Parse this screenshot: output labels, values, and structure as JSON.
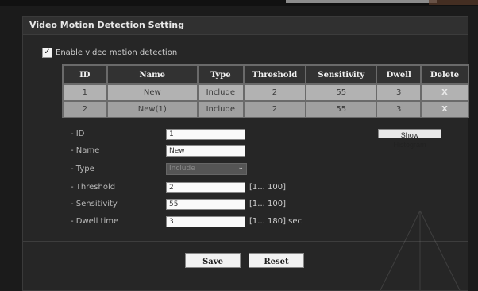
{
  "panel": {
    "title": "Video Motion Detection Setting",
    "enable_checkbox": {
      "checked": true,
      "label": "Enable video motion detection"
    }
  },
  "table": {
    "headers": [
      "ID",
      "Name",
      "Type",
      "Threshold",
      "Sensitivity",
      "Dwell",
      "Delete"
    ],
    "rows": [
      {
        "id": "1",
        "name": "New",
        "type": "Include",
        "threshold": "2",
        "sensitivity": "55",
        "dwell": "3",
        "delete": "X"
      },
      {
        "id": "2",
        "name": "New(1)",
        "type": "Include",
        "threshold": "2",
        "sensitivity": "55",
        "dwell": "3",
        "delete": "X"
      }
    ]
  },
  "form": {
    "id": {
      "label": "- ID",
      "value": "1"
    },
    "name": {
      "label": "- Name",
      "value": "New"
    },
    "type": {
      "label": "- Type",
      "value": "Include"
    },
    "threshold": {
      "label": "- Threshold",
      "value": "2",
      "range": "[1... 100]"
    },
    "sensitivity": {
      "label": "- Sensitivity",
      "value": "55",
      "range": "[1... 100]"
    },
    "dwell": {
      "label": "- Dwell time",
      "value": "3",
      "range": "[1... 180] sec"
    },
    "histogram_button": "Show Histogram"
  },
  "actions": {
    "save": "Save",
    "reset": "Reset"
  },
  "icons": {
    "checkbox": "checkmark-icon",
    "select_chevron": "chevron-down-icon"
  },
  "colors": {
    "background": "#1b1b1b",
    "panel": "#262626",
    "table_row": "#b2b2b2",
    "table_header": "#323232"
  }
}
